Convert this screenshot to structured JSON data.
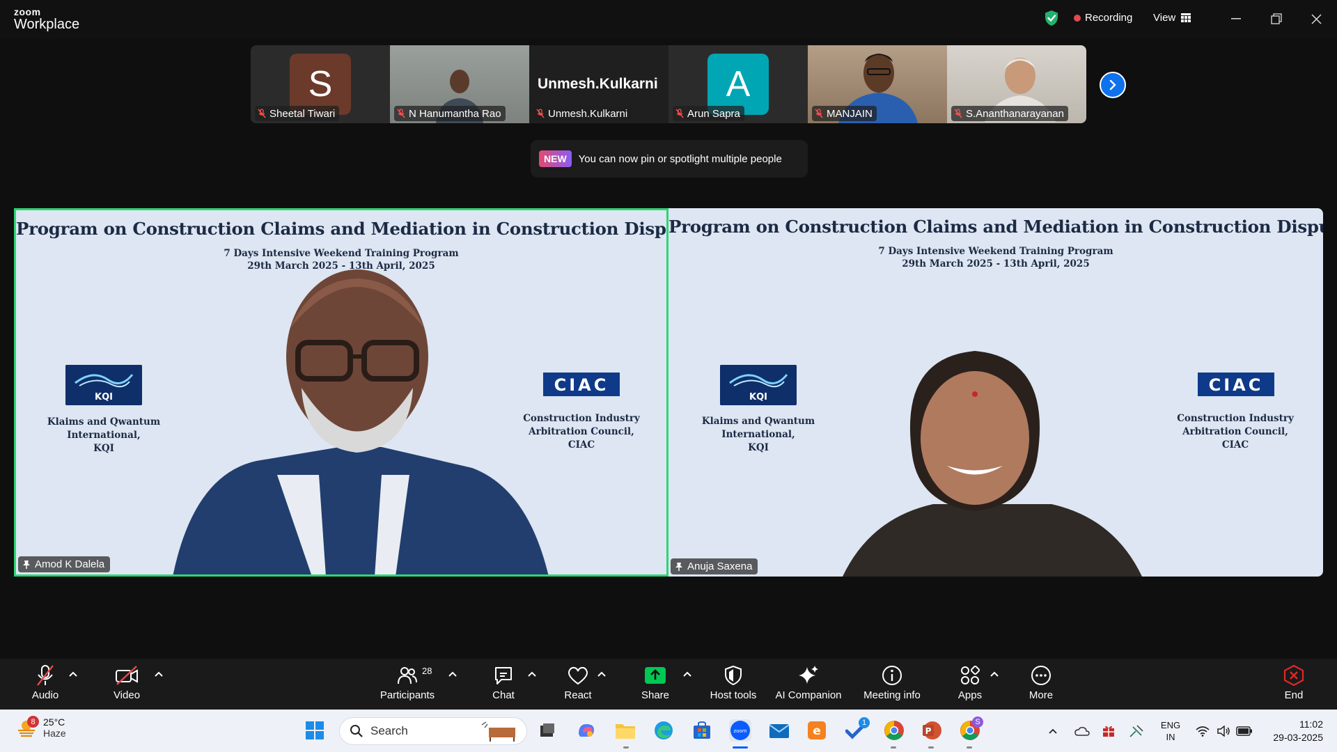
{
  "app": {
    "logo_top": "zoom",
    "logo_bottom": "Workplace"
  },
  "titlebar": {
    "recording_label": "Recording",
    "view_label": "View"
  },
  "thumbnails": [
    {
      "name": "Sheetal Tiwari",
      "avatar_letter": "S",
      "avatar_color": "#6b3a2a",
      "bg": "#2b2b2b",
      "muted": true
    },
    {
      "name": "N Hanumantha Rao",
      "bg": "#8a8f8c",
      "muted": true
    },
    {
      "name": "Unmesh.Kulkarni",
      "big_name": "Unmesh.Kulkarni",
      "bg": "#1f1f1f",
      "muted": true
    },
    {
      "name": "Arun Sapra",
      "avatar_letter": "A",
      "avatar_color": "#00a6b4",
      "bg": "#2b2b2b",
      "muted": true
    },
    {
      "name": "MANJAIN",
      "bg": "#a7917a",
      "muted": true
    },
    {
      "name": "S.Ananthanarayanan",
      "bg": "#cfcac3",
      "muted": true
    }
  ],
  "toast": {
    "badge": "NEW",
    "message": "You can now pin or spotlight multiple people"
  },
  "panes": [
    {
      "title": "Program on Construction Claims and Mediation in Construction Disputes",
      "subtitle1": "7 Days Intensive Weekend Training Program",
      "subtitle2": "29th March 2025 - 13th April, 2025",
      "kqi_logo": "KQI",
      "kqi_line1": "Klaims and Qwantum",
      "kqi_line2": "International,",
      "kqi_line3": "KQI",
      "ciac_logo": "CIAC",
      "ciac_line1": "Construction Industry",
      "ciac_line2": "Arbitration Council,",
      "ciac_line3": "CIAC",
      "speaker": "Amod K Dalela",
      "active_speaker": true
    },
    {
      "title": "Program on Construction Claims and Mediation in Construction Disputes",
      "subtitle1": "7 Days Intensive Weekend Training Program",
      "subtitle2": "29th March 2025 - 13th April, 2025",
      "kqi_logo": "KQI",
      "kqi_line1": "Klaims and Qwantum",
      "kqi_line2": "International,",
      "kqi_line3": "KQI",
      "ciac_logo": "CIAC",
      "ciac_line1": "Construction Industry",
      "ciac_line2": "Arbitration Council,",
      "ciac_line3": "CIAC",
      "speaker": "Anuja Saxena",
      "active_speaker": false
    }
  ],
  "toolbar": {
    "audio": "Audio",
    "video": "Video",
    "participants": "Participants",
    "participants_count": "28",
    "chat": "Chat",
    "react": "React",
    "share": "Share",
    "host_tools": "Host tools",
    "ai_companion": "AI Companion",
    "meeting_info": "Meeting info",
    "apps": "Apps",
    "more": "More",
    "end": "End"
  },
  "taskbar": {
    "weather_temp": "25°C",
    "weather_desc": "Haze",
    "weather_badge": "8",
    "search_placeholder": "Search",
    "lang_top": "ENG",
    "lang_bottom": "IN",
    "time": "11:02",
    "date": "29-03-2025",
    "todo_badge": "1",
    "chrome_badge": "S"
  },
  "colors": {
    "accent": "#0e72ed",
    "active_speaker_border": "#2ed573",
    "share_green": "#00c853",
    "end_red": "#e02828"
  }
}
